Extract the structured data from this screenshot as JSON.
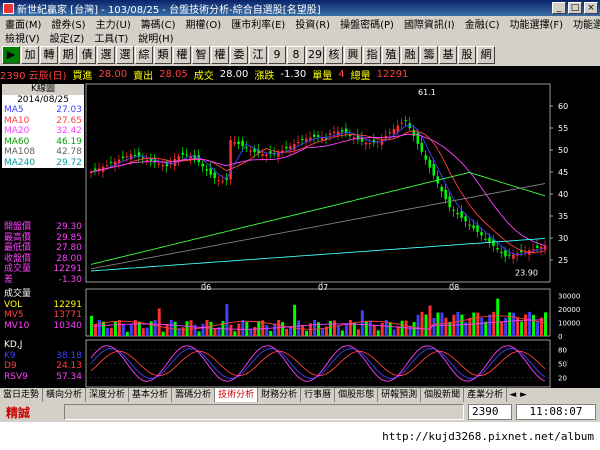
{
  "window": {
    "app_name": "新世紀贏家",
    "title": "新世紀贏家 [台灣] - 103/08/25 - 台盤技術分析-綜合自選股[名望股]",
    "buttons": [
      "_",
      "□",
      "×"
    ]
  },
  "menu1": [
    "畫面(M)",
    "證券(S)",
    "主力(U)",
    "籌碼(C)",
    "期權(O)",
    "匯市利率(E)",
    "投資(R)",
    "操盤密碼(P)",
    "國際資訊(I)",
    "金融(C)",
    "功能選擇(F)",
    "功能選擇(F)"
  ],
  "menu2": [
    "檢視(V)",
    "設定(Z)",
    "工具(T)",
    "說明(H)"
  ],
  "toolbar": [
    "▶",
    "加",
    "轉",
    "期",
    "債",
    "選",
    "選",
    "綜",
    "類",
    "權",
    "智",
    "權",
    "委",
    "江",
    "9",
    "8",
    "29",
    "核",
    "興",
    "指",
    "殖",
    "融",
    "籌",
    "基",
    "股",
    "網"
  ],
  "colors": {
    "up": "#ff3030",
    "down": "#00ff00",
    "ma5": "#4040ff",
    "ma10": "#ff4040",
    "ma20": "#ff40ff",
    "ma60": "#40ff40",
    "ma108": "#808080",
    "ma240": "#40ffff"
  },
  "quote": {
    "code_name": "2390 云辰(日)",
    "bid_label": "買進",
    "bid": "28.00",
    "ask_label": "賣出",
    "ask": "28.05",
    "deal_label": "成交",
    "deal": "28.00",
    "change_label": "漲跌",
    "change": "-1.30",
    "volume_label": "單量",
    "volume": "4",
    "total_label": "總量",
    "total": "12291"
  },
  "kpanel": {
    "title": "K線圖",
    "date": "2014/08/25",
    "mas": [
      {
        "label": "MA5",
        "value": "27.03"
      },
      {
        "label": "MA10",
        "value": "27.65"
      },
      {
        "label": "MA20",
        "value": "32.42"
      },
      {
        "label": "MA60",
        "value": "46.19"
      },
      {
        "label": "MA108",
        "value": "42.78"
      },
      {
        "label": "MA240",
        "value": "29.72"
      }
    ],
    "prices": [
      {
        "label": "開盤價",
        "value": "29.30"
      },
      {
        "label": "最高價",
        "value": "29.85"
      },
      {
        "label": "最低價",
        "value": "27.80"
      },
      {
        "label": "收盤價",
        "value": "28.00"
      },
      {
        "label": "成交量",
        "value": "12291"
      },
      {
        "label": "差",
        "value": "-1.30"
      }
    ],
    "high_mark": "61.1",
    "low_mark": "23.90",
    "y_ticks": [
      "60",
      "55",
      "50",
      "45",
      "40",
      "35",
      "30",
      "25"
    ],
    "x_ticks": [
      "06",
      "07",
      "08"
    ]
  },
  "vpanel": {
    "title": "成交量",
    "rows": [
      {
        "label": "VOL",
        "value": "12291"
      },
      {
        "label": "MV5",
        "value": "13771"
      },
      {
        "label": "MV10",
        "value": "10340"
      }
    ],
    "y_ticks": [
      "30000",
      "20000",
      "10000",
      "0"
    ]
  },
  "kdpanel": {
    "title": "KD,J",
    "rows": [
      {
        "label": "K9",
        "value": "38.18"
      },
      {
        "label": "D9",
        "value": "24.13"
      },
      {
        "label": "RSV9",
        "value": "57.34"
      }
    ],
    "y_ticks": [
      "80",
      "50",
      "20"
    ]
  },
  "tabs": [
    "當日走勢",
    "橫向分析",
    "深度分析",
    "基本分析",
    "籌碼分析",
    "技術分析",
    "財務分析",
    "行事曆",
    "個股形態",
    "研報預測",
    "個股新聞",
    "產業分析"
  ],
  "active_tab": "技術分析",
  "status": {
    "left": "精誠",
    "code": "2390",
    "time": "11:08:07"
  },
  "footer_url": "http://kujd3268.pixnet.net/album"
}
